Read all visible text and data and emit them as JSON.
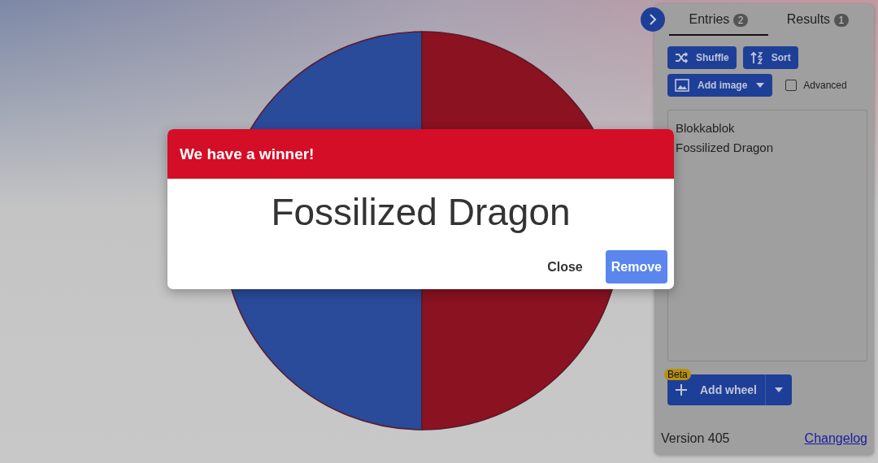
{
  "wheel": {
    "segments": [
      {
        "color": "#2a4a9a"
      },
      {
        "color": "#8a1221"
      }
    ]
  },
  "panel": {
    "tabs": [
      {
        "label": "Entries",
        "count": "2",
        "selected": true
      },
      {
        "label": "Results",
        "count": "1",
        "selected": false
      }
    ],
    "shuffle": "Shuffle",
    "sort": "Sort",
    "add_image": "Add image",
    "advanced": {
      "label": "Advanced",
      "checked": false
    },
    "entries": [
      "Blokkablok",
      "Fossilized Dragon"
    ],
    "add_wheel": {
      "label": "Add wheel",
      "badge": "Beta"
    },
    "version": "Version 405",
    "changelog": "Changelog"
  },
  "dialog": {
    "title": "We have a winner!",
    "winner": "Fossilized Dragon",
    "buttons": [
      {
        "label": "Close",
        "kind": "text"
      },
      {
        "label": "Remove",
        "kind": "primary"
      }
    ]
  }
}
